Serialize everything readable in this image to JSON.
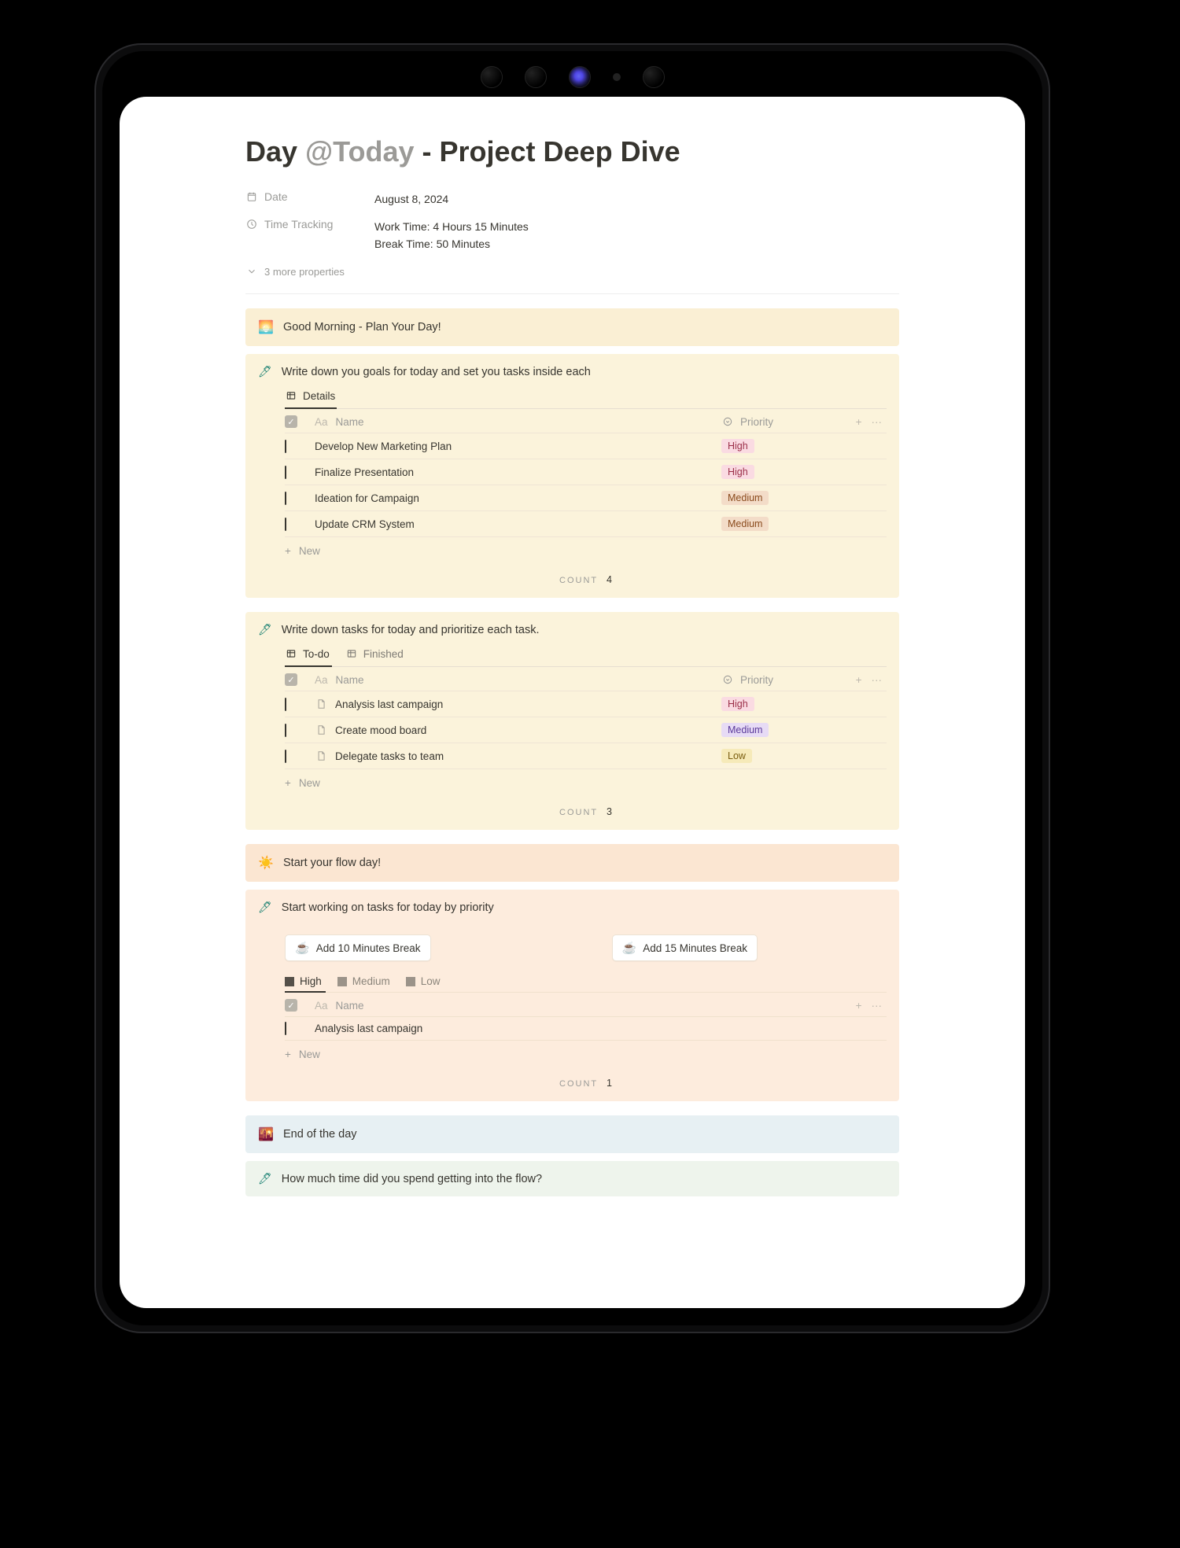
{
  "title": {
    "prefix": "Day ",
    "mention": "@Today",
    "suffix": " - Project Deep Dive"
  },
  "properties": {
    "date": {
      "label": "Date",
      "value": "August 8, 2024"
    },
    "time_tracking": {
      "label": "Time Tracking",
      "work_line": "Work Time: 4 Hours 15 Minutes",
      "break_line": "Break Time:  50 Minutes"
    },
    "more_label": "3 more properties"
  },
  "headers": {
    "name": "Name",
    "name_prefix": "Aa",
    "priority": "Priority",
    "new_row": "New",
    "count_label": "COUNT"
  },
  "morning": {
    "title": "Good Morning - Plan Your Day!",
    "goals": {
      "prompt": "Write down you goals for today and set you tasks inside each",
      "view": "Details",
      "rows": [
        {
          "name": "Develop New Marketing Plan",
          "priority": "High",
          "priority_class": "high"
        },
        {
          "name": "Finalize Presentation",
          "priority": "High",
          "priority_class": "high"
        },
        {
          "name": "Ideation for Campaign",
          "priority": "Medium",
          "priority_class": "medium"
        },
        {
          "name": "Update CRM System",
          "priority": "Medium",
          "priority_class": "medium"
        }
      ],
      "count": "4"
    },
    "tasks": {
      "prompt": "Write down tasks for today and prioritize each task.",
      "views": {
        "active": "To-do",
        "inactive": "Finished"
      },
      "rows": [
        {
          "name": "Analysis last campaign",
          "priority": "High",
          "priority_class": "high"
        },
        {
          "name": "Create mood board",
          "priority": "Medium",
          "priority_class": "medium-purple"
        },
        {
          "name": "Delegate tasks to team",
          "priority": "Low",
          "priority_class": "low"
        }
      ],
      "count": "3"
    }
  },
  "flow": {
    "title": "Start your flow day!",
    "prompt": "Start working on tasks for today by priority",
    "buttons": {
      "b10": "Add 10 Minutes Break",
      "b15": "Add 15 Minutes Break"
    },
    "filters": {
      "high": "High",
      "medium": "Medium",
      "low": "Low"
    },
    "rows": [
      {
        "name": "Analysis last campaign"
      }
    ],
    "count": "1"
  },
  "end": {
    "title": "End of the day",
    "q1": "How much time did you spend getting into the flow?"
  }
}
